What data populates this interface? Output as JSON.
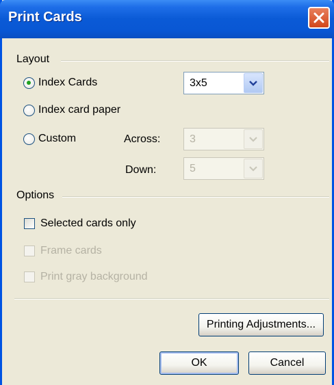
{
  "window": {
    "title": "Print Cards"
  },
  "layout": {
    "group_label": "Layout",
    "index_cards": {
      "label": "Index Cards",
      "selected": true,
      "size_value": "3x5"
    },
    "index_card_paper": {
      "label": "Index card paper",
      "selected": false
    },
    "custom": {
      "label": "Custom",
      "selected": false,
      "across_label": "Across:",
      "across_value": "3",
      "down_label": "Down:",
      "down_value": "5"
    }
  },
  "options": {
    "group_label": "Options",
    "selected_cards_only": {
      "label": "Selected cards only",
      "checked": false,
      "enabled": true
    },
    "frame_cards": {
      "label": "Frame cards",
      "checked": false,
      "enabled": false
    },
    "print_gray_background": {
      "label": "Print gray background",
      "checked": false,
      "enabled": false
    }
  },
  "buttons": {
    "printing_adjustments": "Printing Adjustments...",
    "ok": "OK",
    "cancel": "Cancel"
  },
  "colors": {
    "titlebar": "#0a5ad6",
    "dialog_bg": "#ece9d8",
    "radio_dot": "#21a121",
    "disabled_text": "#b5b2a4"
  }
}
